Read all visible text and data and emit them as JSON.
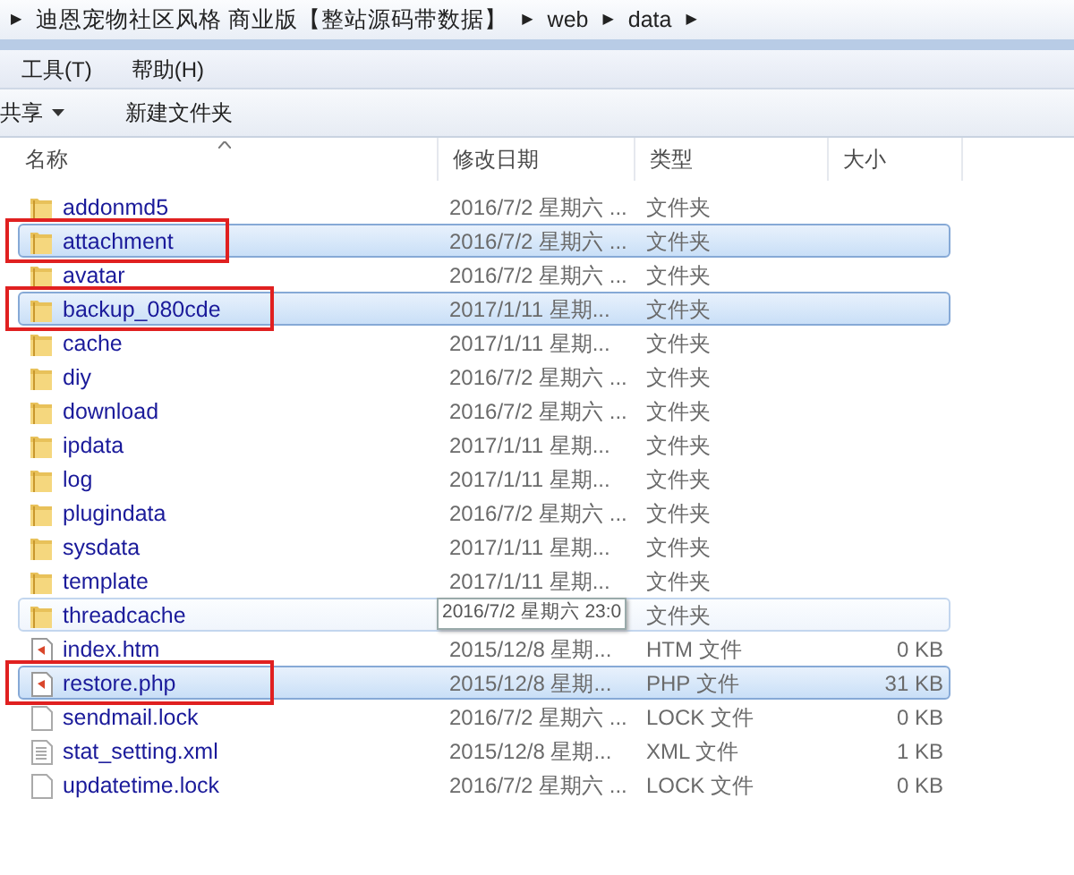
{
  "address_bar": {
    "separator": "▶",
    "segments": [
      "迪恩宠物社区风格 商业版【整站源码带数据】",
      "web",
      "data"
    ]
  },
  "menu": [
    {
      "label": "工具(T)"
    },
    {
      "label": "帮助(H)"
    }
  ],
  "toolbar": [
    {
      "label": "共享",
      "dropdown": true
    },
    {
      "label": "新建文件夹",
      "dropdown": false
    }
  ],
  "table": {
    "columns": [
      {
        "label": "名称",
        "sorted": true
      },
      {
        "label": "修改日期",
        "sorted": false
      },
      {
        "label": "类型",
        "sorted": false
      },
      {
        "label": "大小",
        "sorted": false
      }
    ],
    "rows": [
      {
        "name": "addonmd5",
        "kind": "folder",
        "date": "2016/7/2 星期六 ...",
        "type": "文件夹",
        "selected": false,
        "hovered": false,
        "marked": false
      },
      {
        "name": "attachment",
        "kind": "folder",
        "date": "2016/7/2 星期六 ...",
        "type": "文件夹",
        "selected": true,
        "hovered": false,
        "marked": true
      },
      {
        "name": "avatar",
        "kind": "folder",
        "date": "2016/7/2 星期六 ...",
        "type": "文件夹",
        "selected": false,
        "hovered": false,
        "marked": false
      },
      {
        "name": "backup_080cde",
        "kind": "folder",
        "date": "2017/1/11 星期...",
        "type": "文件夹",
        "selected": true,
        "hovered": false,
        "marked": true
      },
      {
        "name": "cache",
        "kind": "folder",
        "date": "2017/1/11 星期...",
        "type": "文件夹",
        "selected": false,
        "hovered": false,
        "marked": false
      },
      {
        "name": "diy",
        "kind": "folder",
        "date": "2016/7/2 星期六 ...",
        "type": "文件夹",
        "selected": false,
        "hovered": false,
        "marked": false
      },
      {
        "name": "download",
        "kind": "folder",
        "date": "2016/7/2 星期六 ...",
        "type": "文件夹",
        "selected": false,
        "hovered": false,
        "marked": false
      },
      {
        "name": "ipdata",
        "kind": "folder",
        "date": "2017/1/11 星期...",
        "type": "文件夹",
        "selected": false,
        "hovered": false,
        "marked": false
      },
      {
        "name": "log",
        "kind": "folder",
        "date": "2017/1/11 星期...",
        "type": "文件夹",
        "selected": false,
        "hovered": false,
        "marked": false
      },
      {
        "name": "plugindata",
        "kind": "folder",
        "date": "2016/7/2 星期六 ...",
        "type": "文件夹",
        "selected": false,
        "hovered": false,
        "marked": false
      },
      {
        "name": "sysdata",
        "kind": "folder",
        "date": "2017/1/11 星期...",
        "type": "文件夹",
        "selected": false,
        "hovered": false,
        "marked": false
      },
      {
        "name": "template",
        "kind": "folder",
        "date": "2017/1/11 星期...",
        "type": "文件夹",
        "selected": false,
        "hovered": false,
        "marked": false
      },
      {
        "name": "threadcache",
        "kind": "folder",
        "tooltip": "2016/7/2 星期六 23:0",
        "type": "文件夹",
        "selected": false,
        "hovered": true,
        "marked": false
      },
      {
        "name": "index.htm",
        "kind": "web",
        "date": "2015/12/8 星期...",
        "type": "HTM 文件",
        "size": "0 KB",
        "selected": false,
        "hovered": false,
        "marked": false
      },
      {
        "name": "restore.php",
        "kind": "web",
        "date": "2015/12/8 星期...",
        "type": "PHP 文件",
        "size": "31 KB",
        "selected": true,
        "hovered": false,
        "marked": true
      },
      {
        "name": "sendmail.lock",
        "kind": "blank",
        "date": "2016/7/2 星期六 ...",
        "type": "LOCK 文件",
        "size": "0 KB",
        "selected": false,
        "hovered": false,
        "marked": false
      },
      {
        "name": "stat_setting.xml",
        "kind": "text",
        "date": "2015/12/8 星期...",
        "type": "XML 文件",
        "size": "1 KB",
        "selected": false,
        "hovered": false,
        "marked": false
      },
      {
        "name": "updatetime.lock",
        "kind": "blank",
        "date": "2016/7/2 星期六 ...",
        "type": "LOCK 文件",
        "size": "0 KB",
        "selected": false,
        "hovered": false,
        "marked": false
      }
    ]
  }
}
